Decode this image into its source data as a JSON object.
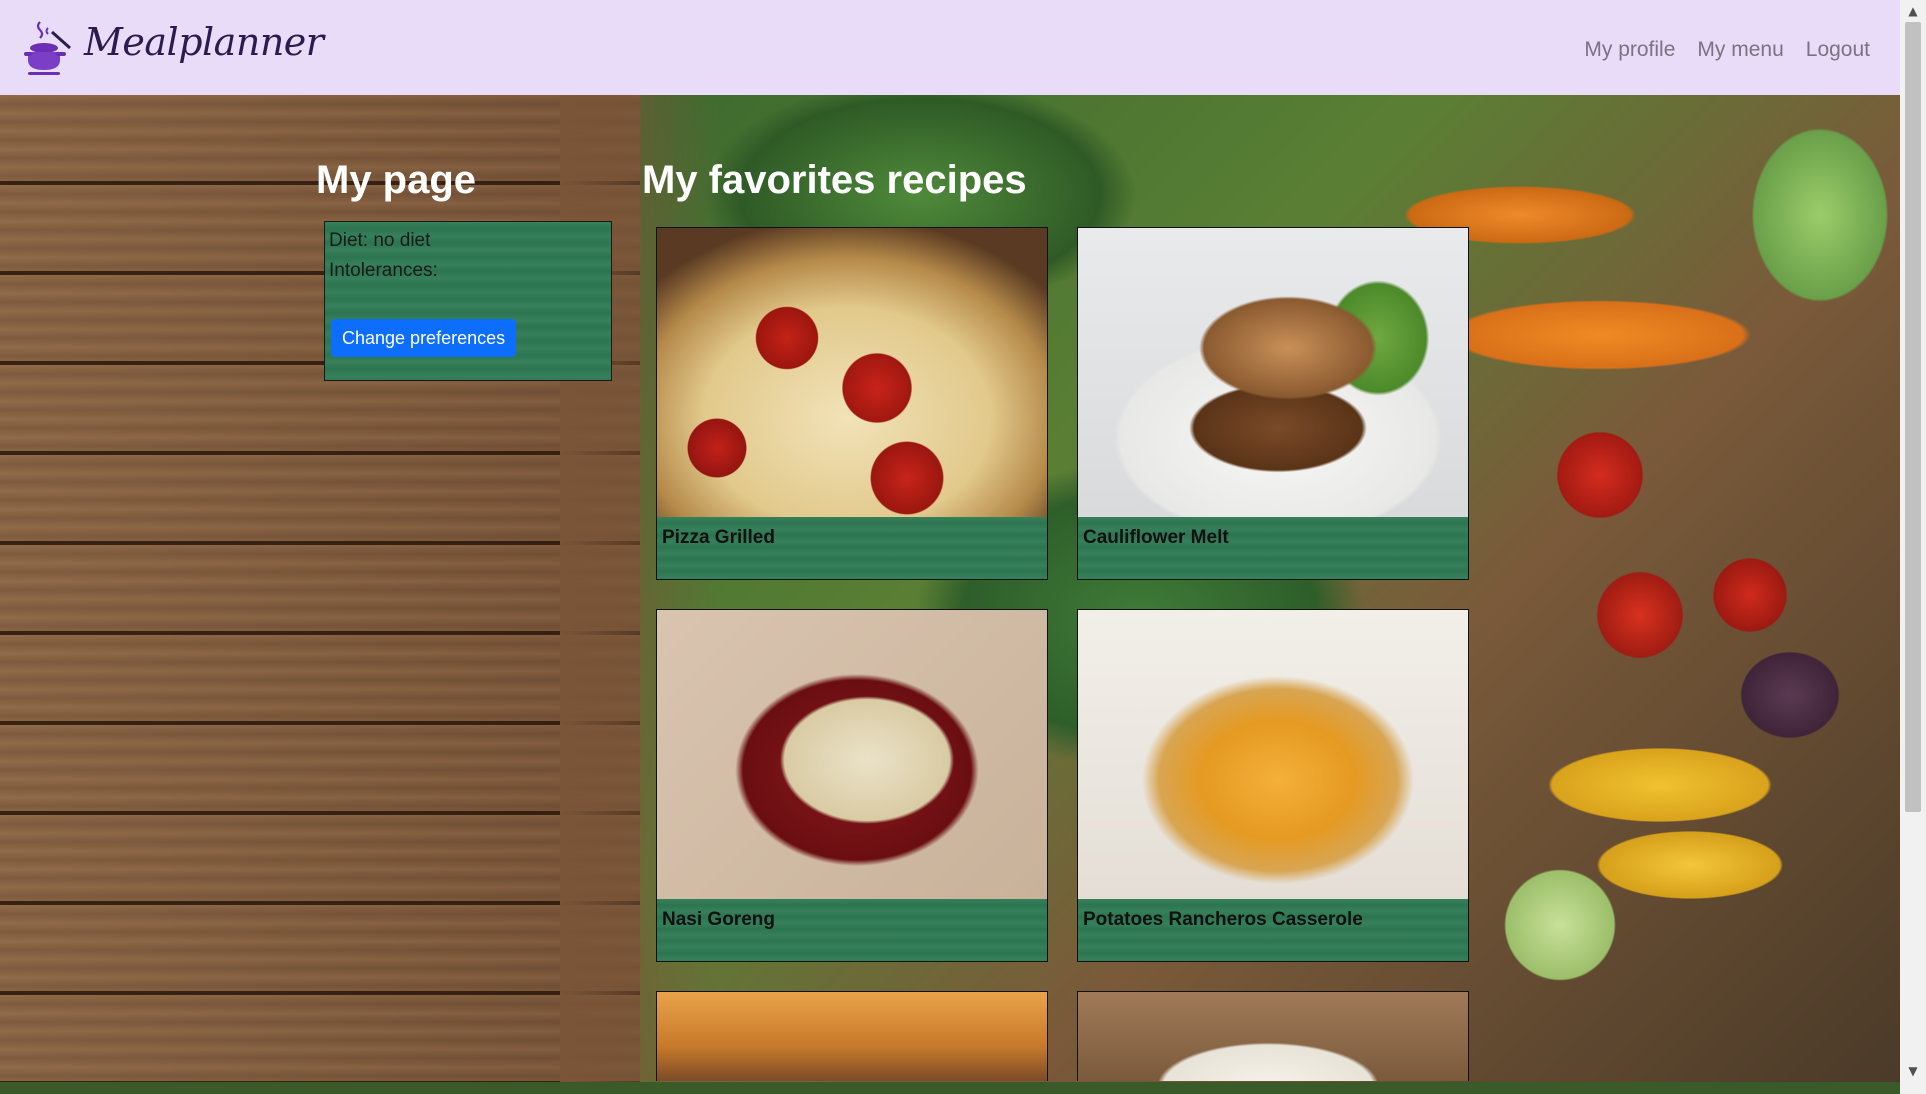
{
  "brand": {
    "name": "Mealplanner",
    "logo_icon": "cooking-pot-icon"
  },
  "nav": {
    "items": [
      "My profile",
      "My menu",
      "Logout"
    ]
  },
  "my_page": {
    "title": "My page",
    "diet_text": "Diet: no diet",
    "intolerances_text": "Intolerances:",
    "change_button": "Change preferences"
  },
  "favorites": {
    "title": "My favorites recipes",
    "recipes": [
      {
        "name": "Pizza Grilled"
      },
      {
        "name": "Cauliflower Melt"
      },
      {
        "name": "Nasi Goreng"
      },
      {
        "name": "Potatoes Rancheros Casserole"
      }
    ]
  },
  "colors": {
    "navbar": "#e9dcf8",
    "panel_green": "#2f7b55",
    "button_blue": "#0d6efd"
  }
}
